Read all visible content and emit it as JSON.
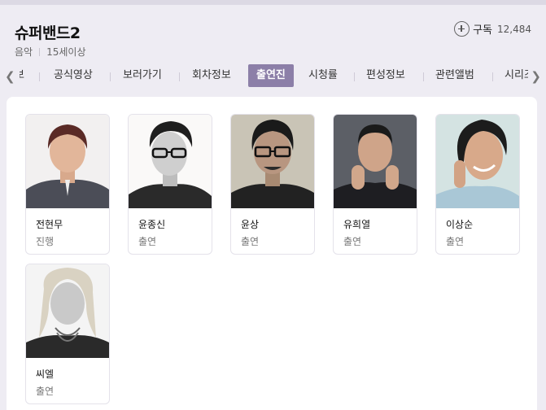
{
  "program": {
    "title": "슈퍼밴드2",
    "genre": "음악",
    "rating": "15세이상"
  },
  "subscribe": {
    "label": "구독",
    "count": "12,484",
    "icon": "plus-circle-icon"
  },
  "tabs": [
    {
      "label": "보"
    },
    {
      "label": "공식영상"
    },
    {
      "label": "보러가기"
    },
    {
      "label": "회차정보"
    },
    {
      "label": "출연진",
      "active": true
    },
    {
      "label": "시청률"
    },
    {
      "label": "편성정보"
    },
    {
      "label": "관련앨범"
    },
    {
      "label": "시리즈"
    }
  ],
  "cast": [
    {
      "name": "전현무",
      "role": "진행"
    },
    {
      "name": "윤종신",
      "role": "출연"
    },
    {
      "name": "윤상",
      "role": "출연"
    },
    {
      "name": "유희열",
      "role": "출연"
    },
    {
      "name": "이상순",
      "role": "출연"
    },
    {
      "name": "씨엘",
      "role": "출연"
    }
  ],
  "colors": {
    "active_tab": "#8c7fa8",
    "background": "#eeecf3"
  }
}
